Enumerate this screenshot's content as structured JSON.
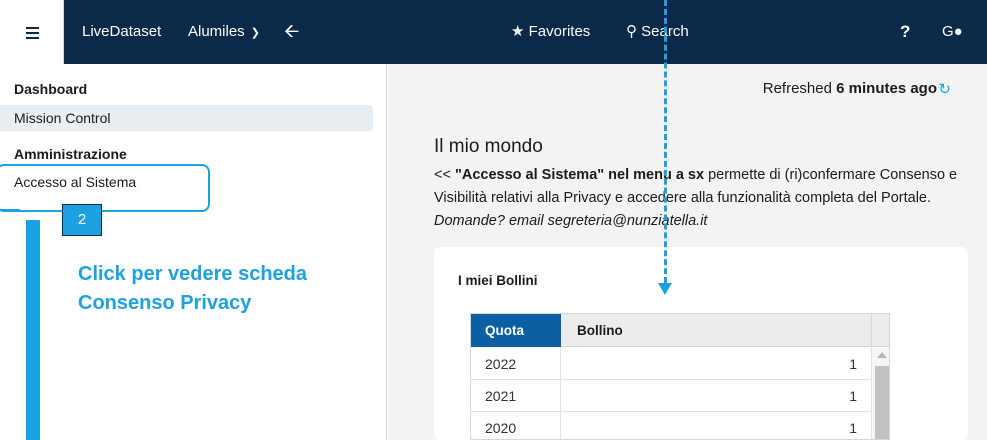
{
  "topbar": {
    "app_name": "LiveDataset",
    "org_name": "Alumiles",
    "org_chevron_icon": "chevron-down-icon",
    "back_icon": "arrow-left-icon",
    "favorites_label": "Favorites",
    "favorites_icon": "star-icon",
    "search_label": "Search",
    "search_icon": "search-icon",
    "help_label": "?",
    "user_initials": "G",
    "user_icon": "user-icon"
  },
  "sidebar": {
    "dashboard_heading": "Dashboard",
    "dashboard_item": "Mission Control",
    "admin_heading": "Amministrazione",
    "admin_item": "Accesso al Sistema"
  },
  "annotation": {
    "step_number": "2",
    "callout_line1": "Click per vedere scheda",
    "callout_line2": "Consenso Privacy",
    "accent_color": "#1da1e2"
  },
  "main": {
    "refreshed_prefix": "Refreshed",
    "refreshed_value": "6 minutes ago",
    "title": "Il mio mondo",
    "desc_prefix": "<<",
    "desc_bold": "\"Accesso al Sistema\" nel menu a sx",
    "desc_text": "permette di (ri)confermare Consenso e Visibilità relativi alla Privacy e accedere alla funzionalità completa del Portale.",
    "desc_italic": "Domande? email segreteria@nunziatella.it"
  },
  "bollini": {
    "title": "I miei Bollini",
    "columns": [
      "Quota",
      "Bollino"
    ],
    "rows": [
      {
        "quota": "2022",
        "bollino": "1"
      },
      {
        "quota": "2021",
        "bollino": "1"
      },
      {
        "quota": "2020",
        "bollino": "1"
      }
    ]
  },
  "colors": {
    "topbar_bg": "#0b2a4a",
    "header_active": "#0d5fa4"
  }
}
